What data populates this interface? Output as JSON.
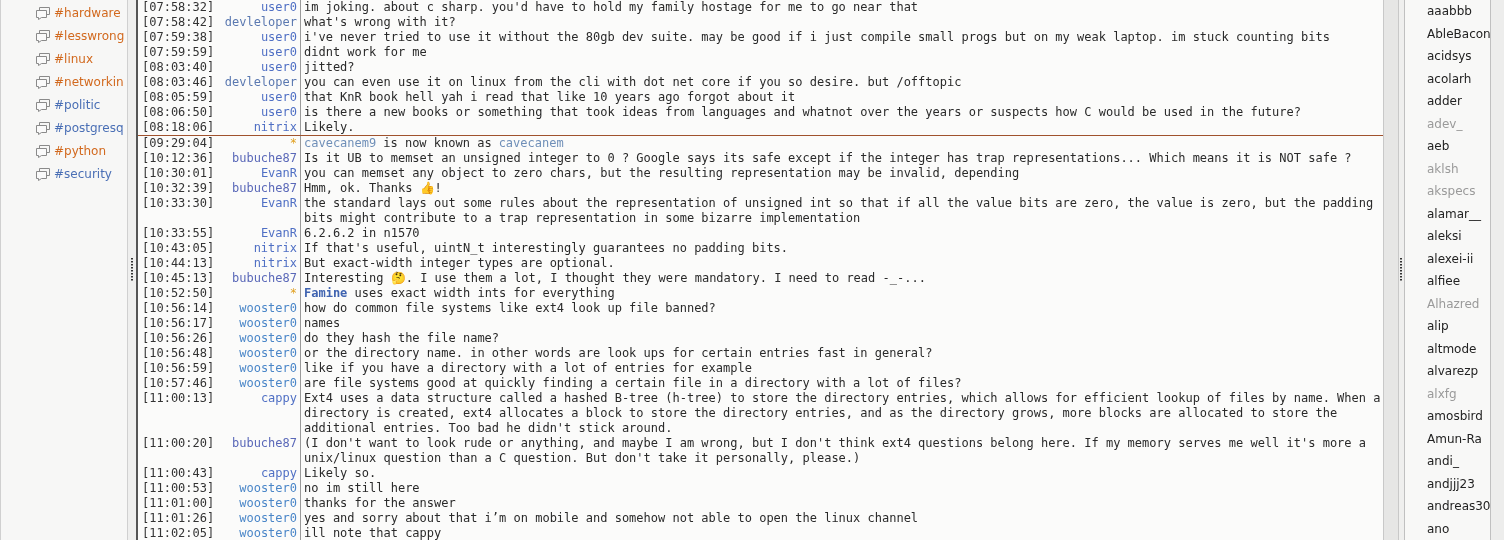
{
  "channels": [
    {
      "name": "#hardware",
      "highlighted": true
    },
    {
      "name": "#lesswrong",
      "highlighted": true
    },
    {
      "name": "#linux",
      "highlighted": true
    },
    {
      "name": "#networkin",
      "highlighted": true
    },
    {
      "name": "#politic",
      "highlighted": false
    },
    {
      "name": "#postgresq",
      "highlighted": false
    },
    {
      "name": "#python",
      "highlighted": true
    },
    {
      "name": "#security",
      "highlighted": false
    }
  ],
  "messages": [
    {
      "kind": "message",
      "time": "[07:58:32]",
      "nick": "user0",
      "color": "#4f6fc4",
      "text": "im joking. about c sharp. you'd have to hold my family hostage for me to go near that"
    },
    {
      "kind": "message",
      "time": "[07:58:42]",
      "nick": "devleloper",
      "color": "#5a78b0",
      "text": "what's wrong with it?"
    },
    {
      "kind": "message",
      "time": "[07:59:38]",
      "nick": "user0",
      "color": "#4f6fc4",
      "text": "i've never tried to use it without the 80gb dev suite. may be good if i just compile small progs but on my weak laptop. im stuck counting bits"
    },
    {
      "kind": "message",
      "time": "[07:59:59]",
      "nick": "user0",
      "color": "#4f6fc4",
      "text": "didnt work for me"
    },
    {
      "kind": "message",
      "time": "[08:03:40]",
      "nick": "user0",
      "color": "#4f6fc4",
      "text": "jitted?"
    },
    {
      "kind": "message",
      "time": "[08:03:46]",
      "nick": "devleloper",
      "color": "#5a78b0",
      "text": "you can even use it on linux from the cli with dot net core if you so desire. but /offtopic"
    },
    {
      "kind": "message",
      "time": "[08:05:59]",
      "nick": "user0",
      "color": "#4f6fc4",
      "text": "that KnR book hell yah i read that like 10 years ago forgot about it"
    },
    {
      "kind": "message",
      "time": "[08:06:50]",
      "nick": "user0",
      "color": "#4f6fc4",
      "text": "is there a new books or something that took ideas from languages and whatnot over the years or suspects how C would be used in the future?"
    },
    {
      "kind": "message",
      "time": "[08:18:06]",
      "nick": "nitrix",
      "color": "#4f6fc4",
      "text": "Likely."
    },
    {
      "kind": "marker"
    },
    {
      "kind": "nick_change",
      "time": "[09:29:04]",
      "nick": "*",
      "old_nick": "cavecanem9",
      "text": "is now known as",
      "new_nick": "cavecanem"
    },
    {
      "kind": "message",
      "time": "[10:12:36]",
      "nick": "bubuche87",
      "color": "#5a68b8",
      "text": "Is it UB to memset an unsigned integer to 0 ? Google says its safe except if the integer has trap representations... Which means it is NOT safe ?"
    },
    {
      "kind": "message",
      "time": "[10:30:01]",
      "nick": "EvanR",
      "color": "#4f6fc4",
      "text": "you can memset any object to zero chars, but the resulting representation may be invalid, depending"
    },
    {
      "kind": "message",
      "time": "[10:32:39]",
      "nick": "bubuche87",
      "color": "#5a68b8",
      "text": "Hmm, ok. Thanks 👍!"
    },
    {
      "kind": "message",
      "time": "[10:33:30]",
      "nick": "EvanR",
      "color": "#4f6fc4",
      "text": "the standard lays out some rules about the representation of unsigned int so that if all the value bits are zero, the value is zero, but the padding bits might contribute to a trap representation in some bizarre implementation"
    },
    {
      "kind": "message",
      "time": "[10:33:55]",
      "nick": "EvanR",
      "color": "#4f6fc4",
      "text": "6.2.6.2 in n1570"
    },
    {
      "kind": "message",
      "time": "[10:43:05]",
      "nick": "nitrix",
      "color": "#4f6fc4",
      "text": "If that's useful, uintN_t interestingly guarantees no padding bits."
    },
    {
      "kind": "message",
      "time": "[10:44:13]",
      "nick": "nitrix",
      "color": "#4f6fc4",
      "text": "But exact-width integer types are optional."
    },
    {
      "kind": "message",
      "time": "[10:45:13]",
      "nick": "bubuche87",
      "color": "#5a68b8",
      "text": "Interesting 🤔. I use them a lot, I thought they were mandatory. I need to read -_-..."
    },
    {
      "kind": "action",
      "time": "[10:52:50]",
      "nick": "*",
      "text": "**Famine** uses exact width ints for everything"
    },
    {
      "kind": "message",
      "time": "[10:56:14]",
      "nick": "wooster0",
      "color": "#4a86c8",
      "text": "how do common file systems like ext4 look up file banned?"
    },
    {
      "kind": "message",
      "time": "[10:56:17]",
      "nick": "wooster0",
      "color": "#4a86c8",
      "text": "names"
    },
    {
      "kind": "message",
      "time": "[10:56:26]",
      "nick": "wooster0",
      "color": "#4a86c8",
      "text": "do they hash the file name?"
    },
    {
      "kind": "message",
      "time": "[10:56:48]",
      "nick": "wooster0",
      "color": "#4a86c8",
      "text": "or the directory name. in other words are look ups for certain entries fast in general?"
    },
    {
      "kind": "message",
      "time": "[10:56:59]",
      "nick": "wooster0",
      "color": "#4a86c8",
      "text": "like if you have a directory with a lot of entries for example"
    },
    {
      "kind": "message",
      "time": "[10:57:46]",
      "nick": "wooster0",
      "color": "#4a86c8",
      "text": "are file systems good at quickly finding a certain file in a directory with a lot of files?"
    },
    {
      "kind": "message",
      "time": "[11:00:13]",
      "nick": "cappy",
      "color": "#4f6fc4",
      "text": "Ext4 uses a data structure called a hashed B-tree (h-tree) to store the directory entries, which allows for efficient lookup of files by name. When a directory is created, ext4 allocates a block to store the directory entries, and as the directory grows, more blocks are allocated to store the additional entries. Too bad he didn't stick around."
    },
    {
      "kind": "message",
      "time": "[11:00:20]",
      "nick": "bubuche87",
      "color": "#5a68b8",
      "text": "(I don't want to look rude or anything, and maybe I am wrong, but I don't think ext4 questions belong here. If my memory serves me well it's more a unix/linux question than a C question. But don't take it personally, please.)"
    },
    {
      "kind": "message",
      "time": "[11:00:43]",
      "nick": "cappy",
      "color": "#4f6fc4",
      "text": "Likely so."
    },
    {
      "kind": "message",
      "time": "[11:00:53]",
      "nick": "wooster0",
      "color": "#4a86c8",
      "text": "no im still here"
    },
    {
      "kind": "message",
      "time": "[11:01:00]",
      "nick": "wooster0",
      "color": "#4a86c8",
      "text": "thanks for the answer"
    },
    {
      "kind": "message",
      "time": "[11:01:26]",
      "nick": "wooster0",
      "color": "#4a86c8",
      "text": "yes and sorry about that i’m on mobile and somehow not able to open the linux channel"
    },
    {
      "kind": "message",
      "time": "[11:02:05]",
      "nick": "wooster0",
      "color": "#4a86c8",
      "text": "ill note that cappy"
    }
  ],
  "users": [
    {
      "name": "aaabbb",
      "away": false
    },
    {
      "name": "AbleBacon",
      "away": false
    },
    {
      "name": "acidsys",
      "away": false
    },
    {
      "name": "acolarh",
      "away": false
    },
    {
      "name": "adder",
      "away": false
    },
    {
      "name": "adev_",
      "away": true
    },
    {
      "name": "aeb",
      "away": false
    },
    {
      "name": "aklsh",
      "away": true
    },
    {
      "name": "akspecs",
      "away": true
    },
    {
      "name": "alamar__",
      "away": false
    },
    {
      "name": "aleksi",
      "away": false
    },
    {
      "name": "alexei-ii",
      "away": false
    },
    {
      "name": "alfiee",
      "away": false
    },
    {
      "name": "Alhazred",
      "away": true
    },
    {
      "name": "alip",
      "away": false
    },
    {
      "name": "altmode",
      "away": false
    },
    {
      "name": "alvarezp",
      "away": false
    },
    {
      "name": "alxfg",
      "away": true
    },
    {
      "name": "amosbird",
      "away": false
    },
    {
      "name": "Amun-Ra",
      "away": false
    },
    {
      "name": "andi_",
      "away": false
    },
    {
      "name": "andjjj23",
      "away": false
    },
    {
      "name": "andreas30",
      "away": false
    },
    {
      "name": "ano",
      "away": false
    }
  ]
}
